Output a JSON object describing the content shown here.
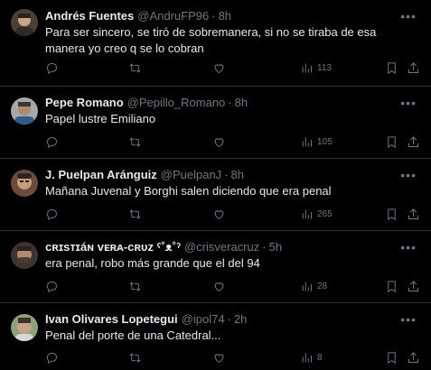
{
  "tweets": [
    {
      "name": "Andrés Fuentes",
      "handle": "@AndruFP96",
      "separator": "·",
      "time": "8h",
      "text": "Para ser sincero, se tiró de sobremanera, si no se tiraba de esa manera yo creo q se lo cobran",
      "views": "113",
      "avatar_color": "#6b5b4a"
    },
    {
      "name": "Pepe Romano",
      "handle": "@Pepillo_Romano",
      "separator": "·",
      "time": "8h",
      "text": "Papel lustre Emiliano",
      "views": "105",
      "avatar_color": "#8a8f96"
    },
    {
      "name": "J. Puelpan Aránguiz",
      "handle": "@PuelpanJ",
      "separator": "·",
      "time": "8h",
      "text": "Mañana Juvenal y Borghi salen diciendo que era penal",
      "views": "265",
      "avatar_color": "#7a5a4a"
    },
    {
      "name": "ᴄʀɪsᴛɪáɴ ᴠᴇʀᴀ-ᴄʀᴜᴢ ˁ˚ᴥ˚ˀ",
      "handle": "@crisveracruz",
      "separator": "·",
      "time": "5h",
      "text": "era penal, robo más grande que el del 94",
      "views": "28",
      "avatar_color": "#5d4c43"
    },
    {
      "name": "Ivan Olivares Lopetegui",
      "handle": "@ipol74",
      "separator": "·",
      "time": "2h",
      "text": "Penal del porte de una Catedral...",
      "views": "8",
      "avatar_color": "#7d8a6a"
    }
  ],
  "colors": {
    "background": "#000000",
    "text": "#e7e9ea",
    "muted": "#71767b",
    "divider": "#2f3336"
  },
  "icons": {
    "more": "more-icon",
    "reply": "reply-icon",
    "retweet": "retweet-icon",
    "like": "like-icon",
    "views": "views-icon",
    "bookmark": "bookmark-icon",
    "share": "share-icon"
  }
}
